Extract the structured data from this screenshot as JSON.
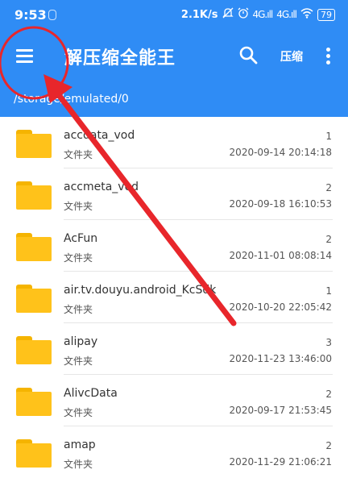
{
  "status_bar": {
    "time": "9:53",
    "net_speed": "2.1K/s",
    "signal_1": "4G.ıll",
    "signal_2": "4G.ıll",
    "battery": "79"
  },
  "app_bar": {
    "title": "解压缩全能王",
    "compress_label": "压缩"
  },
  "path": "/storage/emulated/0",
  "items": [
    {
      "name": "accdata_vod",
      "type": "文件夹",
      "count": "1",
      "date": "2020-09-14 20:14:18"
    },
    {
      "name": "accmeta_vod",
      "type": "文件夹",
      "count": "2",
      "date": "2020-09-18 16:10:53"
    },
    {
      "name": "AcFun",
      "type": "文件夹",
      "count": "2",
      "date": "2020-11-01 08:08:14"
    },
    {
      "name": "air.tv.douyu.android_KcSdk",
      "type": "文件夹",
      "count": "1",
      "date": "2020-10-20 22:05:42"
    },
    {
      "name": "alipay",
      "type": "文件夹",
      "count": "3",
      "date": "2020-11-23 13:46:00"
    },
    {
      "name": "AlivcData",
      "type": "文件夹",
      "count": "2",
      "date": "2020-09-17 21:53:45"
    },
    {
      "name": "amap",
      "type": "文件夹",
      "count": "2",
      "date": "2020-11-29 21:06:21"
    }
  ],
  "colors": {
    "primary": "#2f8cf5",
    "folder": "#ffc21a",
    "annotation": "#e8262b"
  }
}
